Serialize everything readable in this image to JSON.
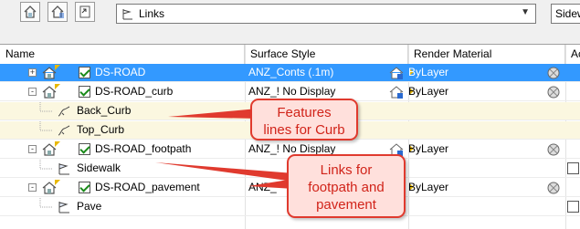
{
  "toolbar": {
    "buttons": [
      "house-pencil-icon",
      "house-list-icon",
      "export-icon"
    ],
    "dropdown_value": "Links",
    "side_button_label": "Sidew"
  },
  "columns": {
    "name": "Name",
    "surface_style": "Surface Style",
    "render_material": "Render Material",
    "extra": "Ac"
  },
  "rows": [
    {
      "name": "DS-ROAD",
      "surface_style": "ANZ_Conts (.1m)",
      "render_material": "ByLayer",
      "checked": true,
      "selected": true
    },
    {
      "name": "DS-ROAD_curb",
      "surface_style": "ANZ_! No Display",
      "render_material": "ByLayer",
      "checked": true
    },
    {
      "name": "Back_Curb"
    },
    {
      "name": "Top_Curb"
    },
    {
      "name": "DS-ROAD_footpath",
      "surface_style": "ANZ_! No Display",
      "render_material": "ByLayer",
      "checked": true
    },
    {
      "name": "Sidewalk"
    },
    {
      "name": "DS-ROAD_pavement",
      "surface_style": "ANZ_",
      "render_material": "ByLayer",
      "checked": true
    },
    {
      "name": "Pave"
    }
  ],
  "callouts": {
    "features": "Features\nlines for Curb",
    "links": "Links for\nfootpath and\npavement"
  },
  "colors": {
    "selection": "#3399ff",
    "callout_border": "#e03a2e",
    "callout_fill": "#ffe0dc",
    "callout_text": "#d1241a"
  }
}
